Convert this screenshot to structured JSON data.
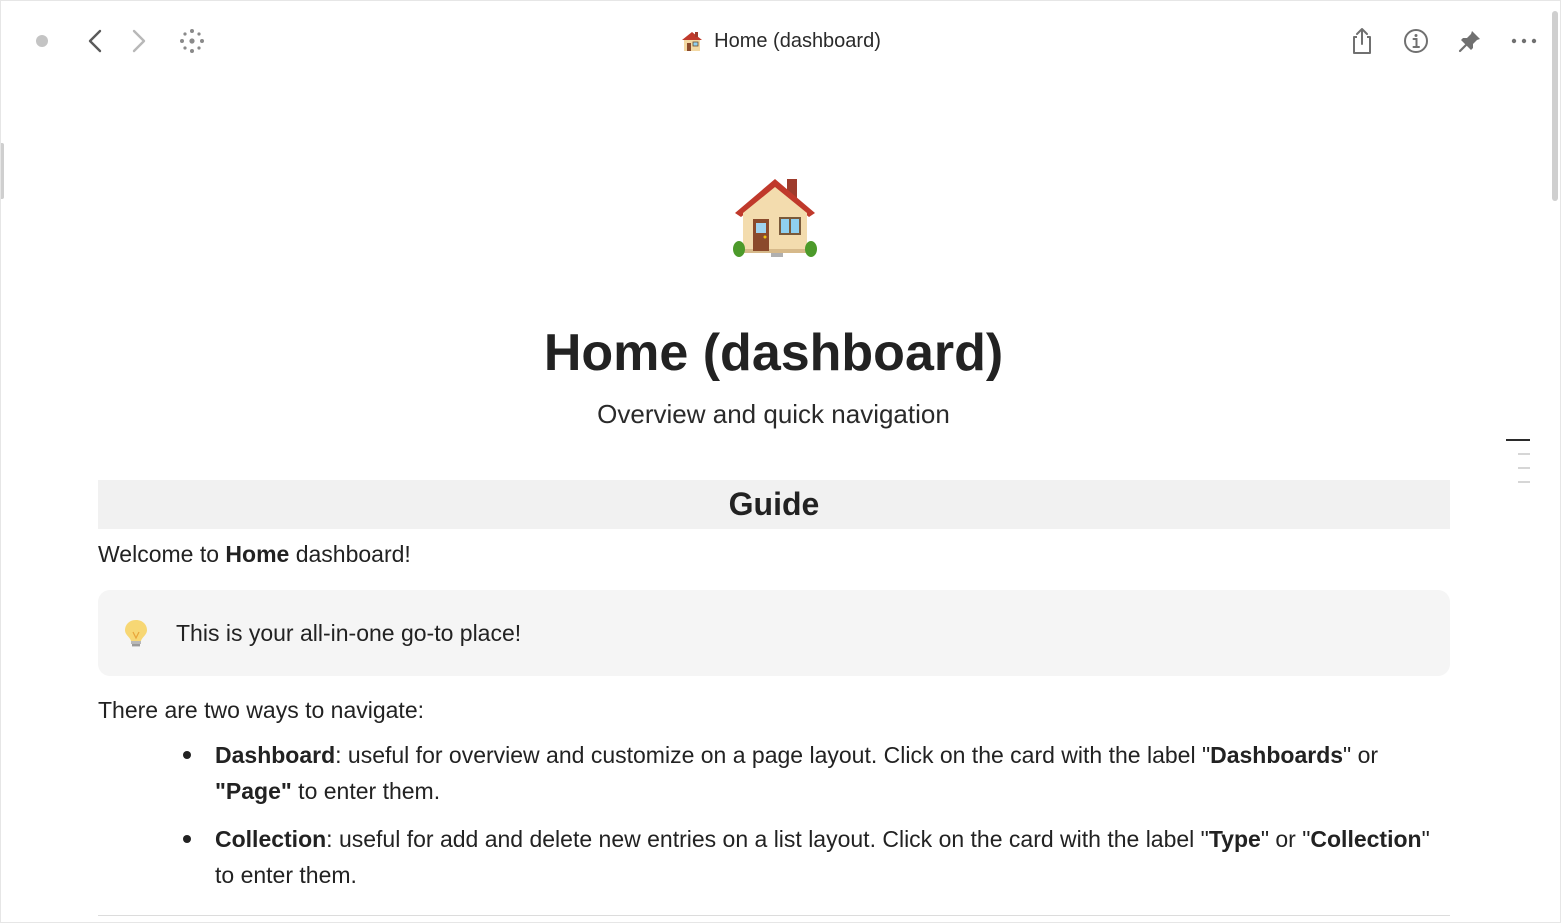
{
  "window": {
    "title": "Home (dashboard)"
  },
  "icons": {
    "page_icon": "house-emoji",
    "callout_icon": "lightbulb-emoji"
  },
  "page": {
    "title": "Home (dashboard)",
    "subtitle": "Overview and quick navigation"
  },
  "guide": {
    "header": "Guide",
    "welcome_pre": "Welcome to ",
    "welcome_bold": "Home",
    "welcome_post": " dashboard!",
    "callout_text": "This is your all-in-one go-to place!",
    "intro": "There are two ways to navigate:",
    "bullets": [
      {
        "term": "Dashboard",
        "text_1": ": useful for overview and customize on a page layout. Click on the card with the label \"",
        "label_1": "Dashboards",
        "text_2": "\" or ",
        "label_2": "\"Page\"",
        "text_3": " to enter them."
      },
      {
        "term": "Collection",
        "text_1": ": useful for add and delete new entries on a list layout. Click on the card with the label  \"",
        "label_1": "Type",
        "text_2": "\" or \"",
        "label_2": "Collection",
        "text_3": "\" to enter them."
      }
    ]
  },
  "colors": {
    "header_bg": "#f1f1f1",
    "callout_bg": "#f5f5f5",
    "text": "#222222"
  }
}
